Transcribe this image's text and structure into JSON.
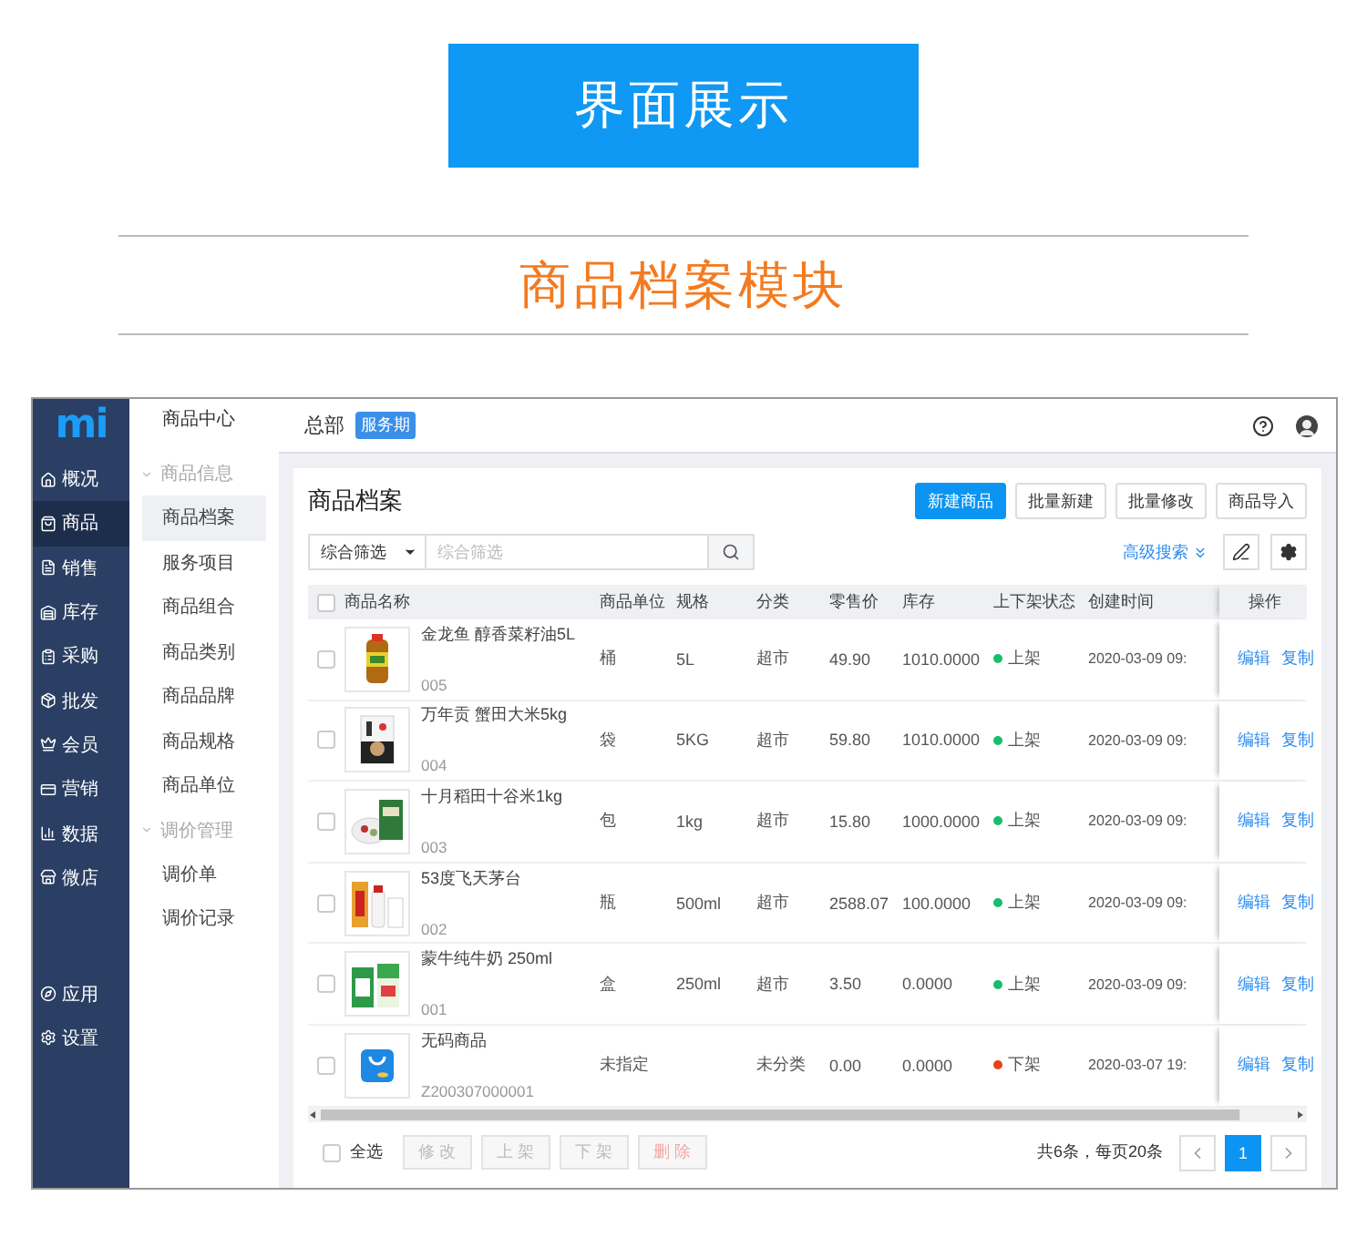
{
  "banner": {
    "title": "界面展示",
    "subtitle": "商品档案模块"
  },
  "app": {
    "logo": "mi",
    "nav": [
      {
        "label": "概况",
        "selected": false
      },
      {
        "label": "商品",
        "selected": true
      },
      {
        "label": "销售",
        "selected": false
      },
      {
        "label": "库存",
        "selected": false
      },
      {
        "label": "采购",
        "selected": false
      },
      {
        "label": "批发",
        "selected": false
      },
      {
        "label": "会员",
        "selected": false
      },
      {
        "label": "营销",
        "selected": false
      },
      {
        "label": "数据",
        "selected": false
      },
      {
        "label": "微店",
        "selected": false
      }
    ],
    "nav_bottom": [
      {
        "label": "应用",
        "selected": false
      },
      {
        "label": "设置",
        "selected": false
      }
    ],
    "sub_nav": {
      "title": "商品中心",
      "groups": [
        {
          "label": "商品信息",
          "expanded": true,
          "items": [
            {
              "label": "商品档案",
              "selected": true
            },
            {
              "label": "服务项目",
              "selected": false
            },
            {
              "label": "商品组合",
              "selected": false
            },
            {
              "label": "商品类别",
              "selected": false
            },
            {
              "label": "商品品牌",
              "selected": false
            },
            {
              "label": "商品规格",
              "selected": false
            },
            {
              "label": "商品单位",
              "selected": false
            }
          ]
        },
        {
          "label": "调价管理",
          "expanded": true,
          "items": [
            {
              "label": "调价单",
              "selected": false
            },
            {
              "label": "调价记录",
              "selected": false
            }
          ]
        }
      ]
    },
    "header": {
      "store": "总部",
      "badge": "服务期"
    },
    "page_title": "商品档案",
    "actions": [
      {
        "label": "新建商品",
        "kind": "primary"
      },
      {
        "label": "批量新建",
        "kind": "default"
      },
      {
        "label": "批量修改",
        "kind": "default"
      },
      {
        "label": "商品导入",
        "kind": "default"
      }
    ],
    "filter": {
      "select": "综合筛选",
      "placeholder": "综合筛选",
      "advanced": "高级搜索"
    },
    "table": {
      "columns": [
        "商品名称",
        "商品单位",
        "规格",
        "分类",
        "零售价",
        "库存",
        "上下架状态",
        "创建时间",
        "操作"
      ],
      "select_all_checked": false,
      "rows": [
        {
          "checked": false,
          "name": "金龙鱼 醇香菜籽油5L",
          "code": "005",
          "unit": "桶",
          "spec": "5L",
          "category": "超市",
          "price": "49.90",
          "stock": "1010.0000",
          "status": "上架",
          "color": "#19be6b",
          "created": "2020-03-09 09:",
          "ops": [
            "编辑",
            "复制"
          ]
        },
        {
          "checked": false,
          "name": "万年贡 蟹田大米5kg",
          "code": "004",
          "unit": "袋",
          "spec": "5KG",
          "category": "超市",
          "price": "59.80",
          "stock": "1010.0000",
          "status": "上架",
          "color": "#19be6b",
          "created": "2020-03-09 09:",
          "ops": [
            "编辑",
            "复制"
          ]
        },
        {
          "checked": false,
          "name": "十月稻田十谷米1kg",
          "code": "003",
          "unit": "包",
          "spec": "1kg",
          "category": "超市",
          "price": "15.80",
          "stock": "1000.0000",
          "status": "上架",
          "color": "#19be6b",
          "created": "2020-03-09 09:",
          "ops": [
            "编辑",
            "复制"
          ]
        },
        {
          "checked": false,
          "name": "53度飞天茅台",
          "code": "002",
          "unit": "瓶",
          "spec": "500ml",
          "category": "超市",
          "price": "2588.07",
          "stock": "100.0000",
          "status": "上架",
          "color": "#19be6b",
          "created": "2020-03-09 09:",
          "ops": [
            "编辑",
            "复制"
          ]
        },
        {
          "checked": false,
          "name": "蒙牛纯牛奶 250ml",
          "code": "001",
          "unit": "盒",
          "spec": "250ml",
          "category": "超市",
          "price": "3.50",
          "stock": "0.0000",
          "status": "上架",
          "color": "#19be6b",
          "created": "2020-03-09 09:",
          "ops": [
            "编辑",
            "复制"
          ]
        },
        {
          "checked": false,
          "image": {
            "kind": "icon"
          },
          "name": "无码商品",
          "code": "Z200307000001",
          "unit": "未指定",
          "category": "未分类",
          "price": "0.00",
          "stock": "0.0000",
          "status": "下架",
          "color": "#ed4014",
          "created": "2020-03-07 19:",
          "ops": [
            "编辑",
            "复制"
          ]
        }
      ]
    },
    "footer": {
      "select_all": "全选",
      "select_all_checked": false,
      "buttons": [
        {
          "label": "修 改",
          "kind": "default",
          "disabled": true
        },
        {
          "label": "上 架",
          "kind": "default",
          "disabled": true
        },
        {
          "label": "下 架",
          "kind": "default",
          "disabled": true
        },
        {
          "label": "删 除",
          "kind": "danger",
          "disabled": true
        }
      ],
      "summary": "共6条，每页20条",
      "pages": [
        {
          "label": "1",
          "selected": true
        }
      ]
    }
  }
}
